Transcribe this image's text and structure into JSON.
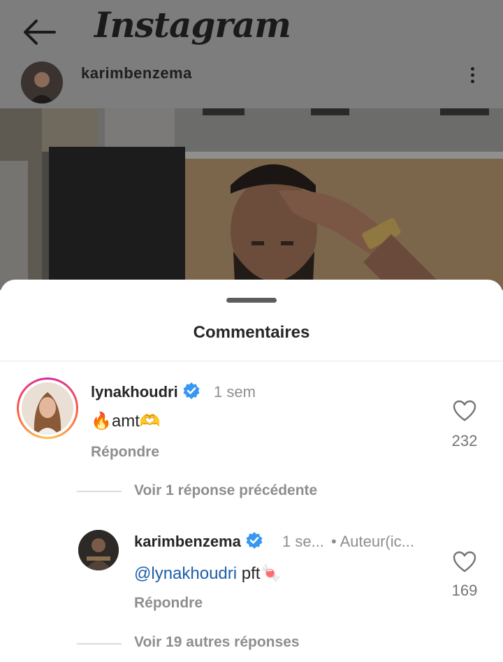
{
  "app": {
    "logo_text": "Instagram"
  },
  "post": {
    "username": "karimbenzema"
  },
  "sheet": {
    "title": "Commentaires"
  },
  "comment": {
    "username": "lynakhoudri",
    "time": "1 sem",
    "text": "🔥amt🫶",
    "reply_label": "Répondre",
    "likes": "232"
  },
  "view_previous_label": "Voir 1 réponse précédente",
  "reply": {
    "username": "karimbenzema",
    "time": "1 se...",
    "author_label": "• Auteur(ic...",
    "mention": "@lynakhoudri",
    "text": " pft🍬",
    "reply_label": "Répondre",
    "likes": "169"
  },
  "view_more_label": "Voir 19 autres réponses",
  "colors": {
    "verified_blue": "#3897f0",
    "mention_blue": "#1e5ea8",
    "muted_text": "#8e8e8e",
    "dim_overlay": "#7d7d7d"
  }
}
